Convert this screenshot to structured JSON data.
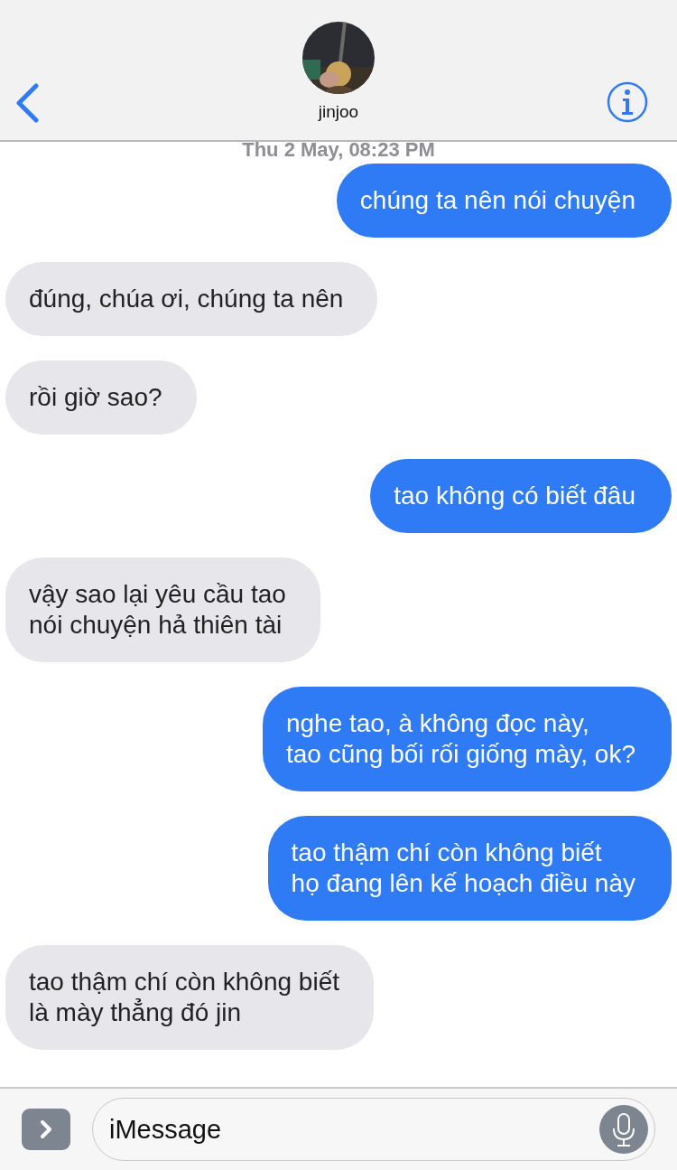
{
  "header": {
    "contact_name": "jinjoo"
  },
  "timestamp": "Thu 2 May, 08:23 PM",
  "messages": [
    {
      "kind": "sent",
      "lines": [
        "chúng ta nên nói chuyện"
      ]
    },
    {
      "kind": "received",
      "lines": [
        "đúng, chúa ơi, chúng ta nên"
      ]
    },
    {
      "kind": "received",
      "lines": [
        "rồi giờ sao?"
      ]
    },
    {
      "kind": "sent",
      "lines": [
        "tao không có biết đâu"
      ]
    },
    {
      "kind": "received",
      "lines": [
        "vậy sao lại yêu cầu tao",
        "nói chuyện hả thiên tài"
      ]
    },
    {
      "kind": "sent",
      "lines": [
        "nghe tao, à không đọc này,",
        "tao cũng bối rối giống mày, ok?"
      ]
    },
    {
      "kind": "sent",
      "lines": [
        "tao thậm chí còn không biết",
        "họ đang lên kế hoạch điều này"
      ]
    },
    {
      "kind": "received",
      "lines": [
        "tao thậm chí còn không biết",
        "là mày thẳng đó jin"
      ]
    }
  ],
  "composer": {
    "placeholder": "iMessage"
  }
}
